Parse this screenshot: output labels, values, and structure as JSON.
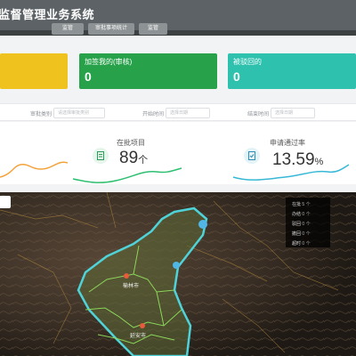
{
  "window": {
    "title": "监督管理业务系统"
  },
  "tabs": [
    {
      "label": "监管"
    },
    {
      "label": "审批事项统计"
    },
    {
      "label": "监管"
    }
  ],
  "cards": [
    {
      "label": "",
      "value": "",
      "color": "#f0c21e"
    },
    {
      "label": "加签我的(审核)",
      "value": "0",
      "color": "#27a24a"
    },
    {
      "label": "被驳回的",
      "value": "0",
      "color": "#2ec1ae"
    }
  ],
  "filters": [
    {
      "label": "审批类别",
      "placeholder": "请选择审批类别"
    },
    {
      "label": "开始时间",
      "placeholder": "选择日期"
    },
    {
      "label": "结束时间",
      "placeholder": "选择日期"
    }
  ],
  "stats": [
    {
      "label": "",
      "value": "",
      "unit": ""
    },
    {
      "label": "在批项目",
      "value": "89",
      "unit": "个"
    },
    {
      "label": "申请通过率",
      "value": "13.59",
      "unit": "%"
    }
  ],
  "map": {
    "city_labels": [
      "榆林市",
      "延安市"
    ],
    "legend": [
      {
        "name": "在批",
        "count": "5 个"
      },
      {
        "name": "办结",
        "count": "0 个"
      },
      {
        "name": "驳回",
        "count": "0 个"
      },
      {
        "name": "撤回",
        "count": "0 个"
      },
      {
        "name": "超时",
        "count": "0 个"
      }
    ]
  },
  "colors": {
    "header": "#5c6265",
    "accent_green": "#27a24a",
    "accent_teal": "#2ec1ae",
    "accent_yellow": "#f0c21e",
    "region_outline": "#4fd3d8"
  }
}
